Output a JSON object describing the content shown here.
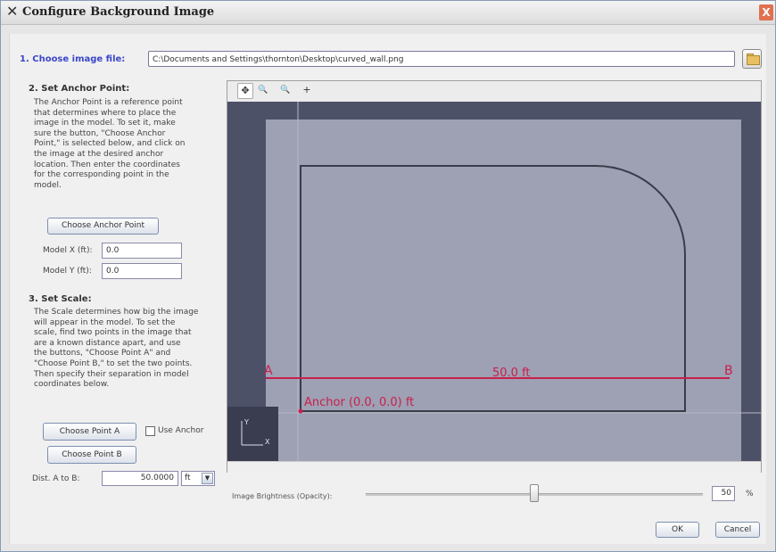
{
  "window": {
    "title": "Configure Background Image",
    "close_label": "X"
  },
  "section1": {
    "label": "1. Choose image file:",
    "file_path": "C:\\Documents and Settings\\thornton\\Desktop\\curved_wall.png"
  },
  "section2": {
    "title": "2. Set Anchor Point:",
    "lines": [
      "The Anchor Point is a reference point",
      "that determines where to place the",
      "image in the model. To set it, make",
      "sure the button, \"Choose Anchor",
      "Point,\" is selected below, and click on",
      "the image at the desired anchor",
      "location. Then enter the coordinates",
      "for the corresponding point in the",
      "model."
    ],
    "choose_anchor_label": "Choose Anchor Point",
    "model_x_label": "Model X (ft):",
    "model_x_value": "0.0",
    "model_y_label": "Model Y (ft):",
    "model_y_value": "0.0"
  },
  "section3": {
    "title": "3. Set Scale:",
    "lines": [
      "The Scale determines how big the image",
      "will appear in the model. To set the",
      "scale, find two points in the image that",
      "are a known distance apart, and use",
      "the buttons, \"Choose Point A\" and",
      "\"Choose Point B,\" to set the two points.",
      "Then specify their separation in model",
      "coordinates below."
    ],
    "choose_point_a_label": "Choose Point A",
    "use_anchor_label": "Use Anchor",
    "choose_point_b_label": "Choose Point B",
    "dist_label": "Dist. A to B:",
    "dist_value": "50.0000",
    "unit_value": "ft"
  },
  "viewer": {
    "tools": [
      {
        "icon": "pan-icon",
        "glyph": "✥"
      },
      {
        "icon": "zoom-in-icon",
        "glyph": "🔍"
      },
      {
        "icon": "zoom-fit-icon",
        "glyph": "🔍"
      },
      {
        "icon": "crosshair-icon",
        "glyph": "+"
      }
    ],
    "point_a_label": "A",
    "point_b_label": "B",
    "distance_label": "50.0 ft",
    "anchor_label": "Anchor (0.0, 0.0) ft",
    "axis_y_label": "Y",
    "axis_x_label": "X",
    "colors": {
      "background": "#4d5168",
      "image": "#9ea0b4",
      "measure": "#c8204a"
    }
  },
  "brightness": {
    "label": "Image Brightness (Opacity):",
    "value": "50",
    "unit": "%",
    "fraction": 0.5
  },
  "footer": {
    "ok_label": "OK",
    "cancel_label": "Cancel"
  }
}
